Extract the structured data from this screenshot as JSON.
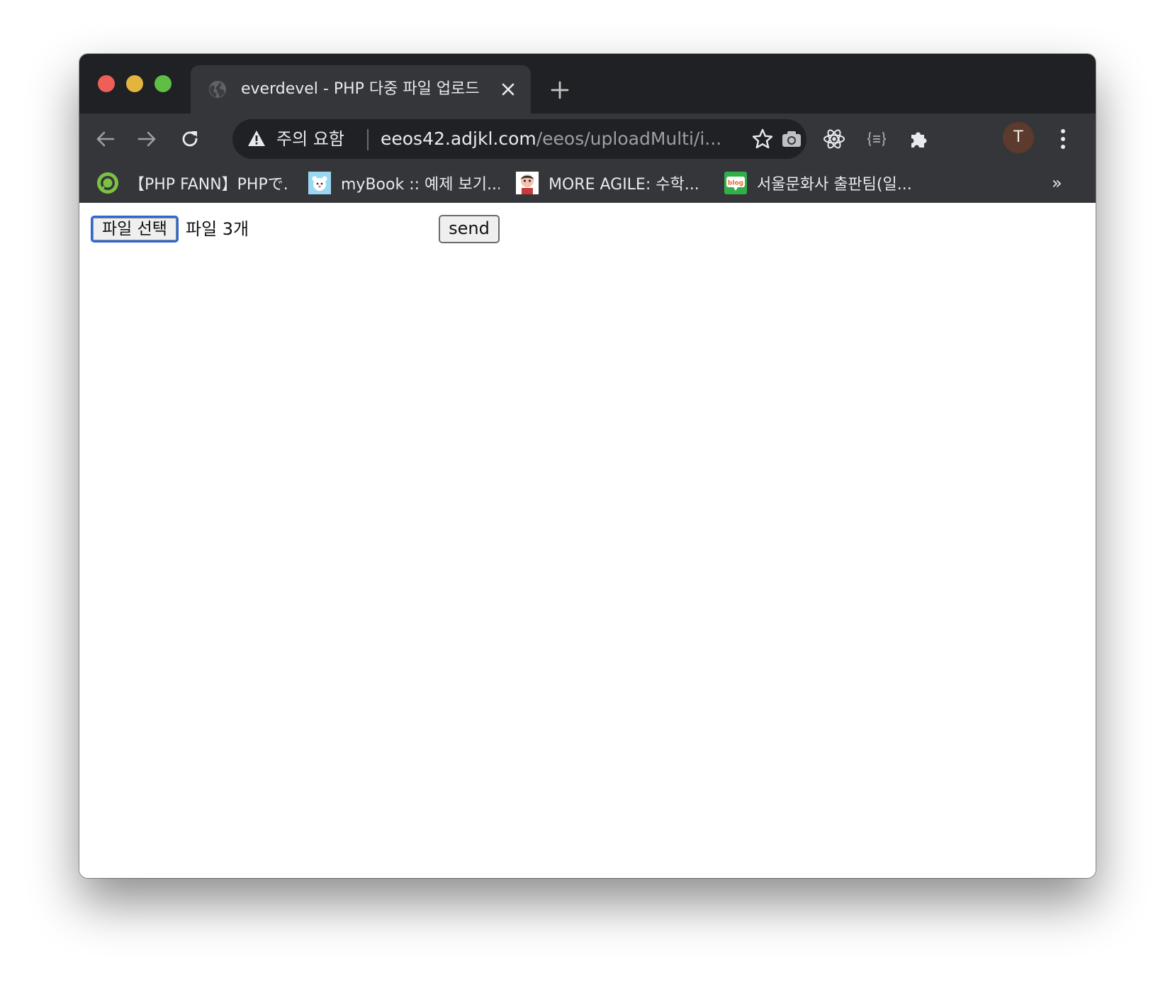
{
  "browser": {
    "tab": {
      "title": "everdevel - PHP 다중 파일 업로드"
    },
    "address_bar": {
      "security_label": "주의 요함",
      "url_host": "eeos42.adjkl.com",
      "url_path": "/eeos/uploadMulti/i..."
    },
    "profile_initial": "T",
    "bookmarks": [
      {
        "label": "【PHP FANN】PHPで...",
        "icon": "fann-logo-icon"
      },
      {
        "label": "myBook :: 예제 보기...",
        "icon": "mybook-favicon-icon"
      },
      {
        "label": "MORE AGILE: 수학...",
        "icon": "avatar-favicon-icon"
      },
      {
        "label": "서울문화사 출판팀(일...",
        "icon": "blog-favicon-icon",
        "icon_text": "blog"
      }
    ],
    "bookmarks_overflow": "»"
  },
  "page": {
    "file_button_label": "파일 선택",
    "file_status": "파일 3개",
    "send_label": "send"
  },
  "colors": {
    "chrome_dark": "#202124",
    "chrome_toolbar": "#35363a",
    "focus_ring": "#2a6ad8"
  }
}
